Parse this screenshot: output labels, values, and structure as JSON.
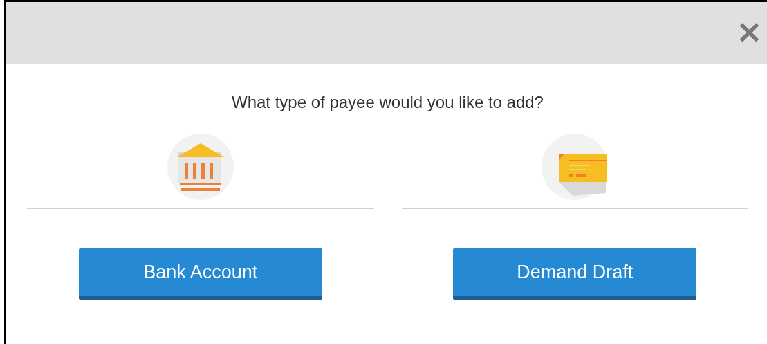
{
  "dialog": {
    "close_label": "✕",
    "question": "What type of payee would you like to add?",
    "options": [
      {
        "kind": "bank",
        "button": "Bank Account"
      },
      {
        "kind": "draft",
        "button": "Demand Draft"
      }
    ]
  }
}
